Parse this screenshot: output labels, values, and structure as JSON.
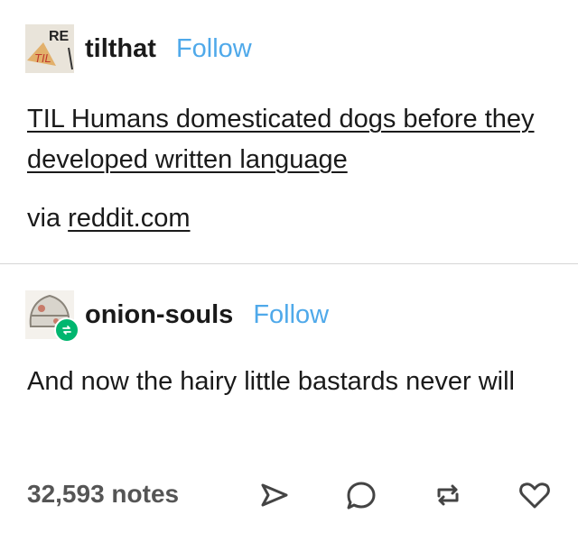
{
  "post": {
    "author": "tilthat",
    "follow_label": "Follow",
    "avatar_text_1": "RE",
    "avatar_text_2": "TIL",
    "title": "TIL Humans domesticated dogs before they developed written language",
    "via_prefix": "via",
    "via_link": "reddit.com"
  },
  "reblog": {
    "author": "onion-souls",
    "follow_label": "Follow",
    "text": "And now the hairy little bastards never will"
  },
  "footer": {
    "notes": "32,593 notes",
    "icons": [
      "share-icon",
      "reply-icon",
      "reblog-icon",
      "like-icon"
    ]
  },
  "colors": {
    "follow": "#4fa9ea",
    "reblog_badge": "#00b66f",
    "divider": "#d6d6d6"
  }
}
